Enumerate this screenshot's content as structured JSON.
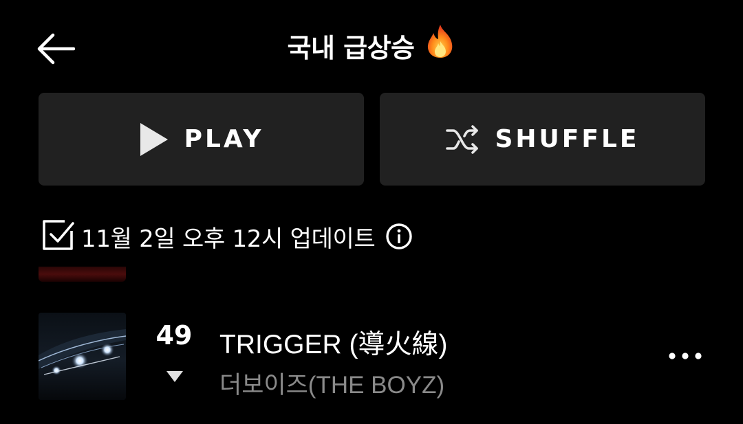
{
  "header": {
    "back_icon": "arrow-left-icon",
    "title": "국내 급상승",
    "title_emoji_icon": "fire-icon"
  },
  "actions": {
    "play_label": "PLAY",
    "play_icon": "play-icon",
    "shuffle_label": "SHUFFLE",
    "shuffle_icon": "shuffle-icon"
  },
  "update": {
    "checkbox_icon": "checkbox-checked-icon",
    "text": "11월 2일 오후 12시 업데이트",
    "info_icon": "info-icon"
  },
  "tracks": [
    {
      "rank": "49",
      "rank_change_icon": "triangle-down-icon",
      "title": "TRIGGER (導火線)",
      "artist": "더보이즈(THE BOYZ)",
      "more_icon": "more-horizontal-icon"
    }
  ],
  "colors": {
    "background": "#000000",
    "button_bg": "#212121",
    "text_primary": "#ffffff",
    "text_secondary": "#8a8a8a",
    "rank_down": "#e0e0e0"
  }
}
